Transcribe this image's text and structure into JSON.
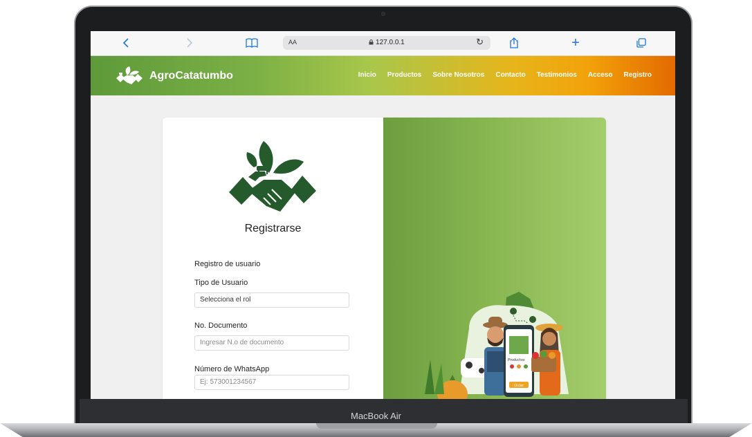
{
  "browser": {
    "address_size": "AA",
    "url": "127.0.0.1"
  },
  "site": {
    "brand": "AgroCatatumbo",
    "nav": [
      "Inicio",
      "Productos",
      "Sobre Nosotros",
      "Contacto",
      "Testimonios",
      "Acceso",
      "Registro"
    ]
  },
  "form": {
    "title": "Registrarse",
    "section": "Registro de usuario",
    "user_type_label": "Tipo de Usuario",
    "user_type_value": "Selecciona el rol",
    "doc_label": "No. Documento",
    "doc_placeholder": "Ingresar N.o de documento",
    "whatsapp_label": "Número de WhatsApp",
    "whatsapp_placeholder": "Ej: 573001234567"
  },
  "illustration": {
    "screen_title": "Productos",
    "button": "Order"
  },
  "device": {
    "label": "MacBook Air"
  },
  "colors": {
    "brand_green": "#5e9a3a",
    "brand_orange": "#e36a00",
    "logo_dark_green": "#255a2c",
    "safari_blue": "#1a73e8"
  },
  "icons": [
    "back-icon",
    "forward-icon",
    "bookmarks-icon",
    "lock-icon",
    "reload-icon",
    "share-icon",
    "new-tab-icon",
    "tabs-icon",
    "handshake-plant-logo-icon"
  ]
}
